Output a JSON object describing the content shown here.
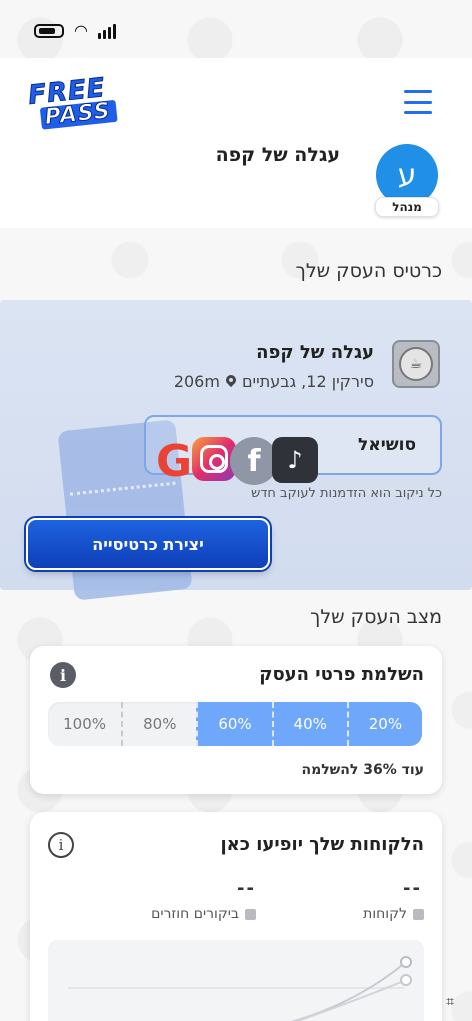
{
  "status_bar": {
    "wifi_icon": "wifi-icon",
    "battery_icon": "battery-icon",
    "signal_icon": "signal-icon"
  },
  "header": {
    "logo_line1": "FREE",
    "logo_line2": "PASS",
    "business_name": "עגלה של קפה",
    "avatar_letter": "ע",
    "role": "מנהל",
    "accent": "#1f6ff0"
  },
  "business_card": {
    "section_title": "כרטיס העסק שלך",
    "name": "עגלה של קפה",
    "address": "סירקין 12, גבעתיים",
    "distance": "206m",
    "social_label": "סושיאל",
    "social_icons": [
      "google-icon",
      "instagram-icon",
      "facebook-icon",
      "tiktok-icon"
    ],
    "social_hint": "כל ניקוב הוא הזדמנות לעוקב חדש",
    "create_button": "יצירת כרטיסייה"
  },
  "business_status": {
    "section_title": "מצב העסק שלך",
    "completion": {
      "title": "השלמת פרטי העסק",
      "steps": [
        "20%",
        "40%",
        "60%",
        "80%",
        "100%"
      ],
      "completed_steps": 3,
      "note": "עוד 36% להשלמה"
    },
    "customers": {
      "title": "הלקוחות שלך יופיעו כאן",
      "metric_customers": "--",
      "metric_returning": "--",
      "legend_customers": "לקוחות",
      "legend_returning": "ביקורים חוזרים"
    }
  },
  "colors": {
    "primary": "#0e3fb8",
    "progress_on": "#6fa8fb",
    "panel": "#d6dff0"
  }
}
